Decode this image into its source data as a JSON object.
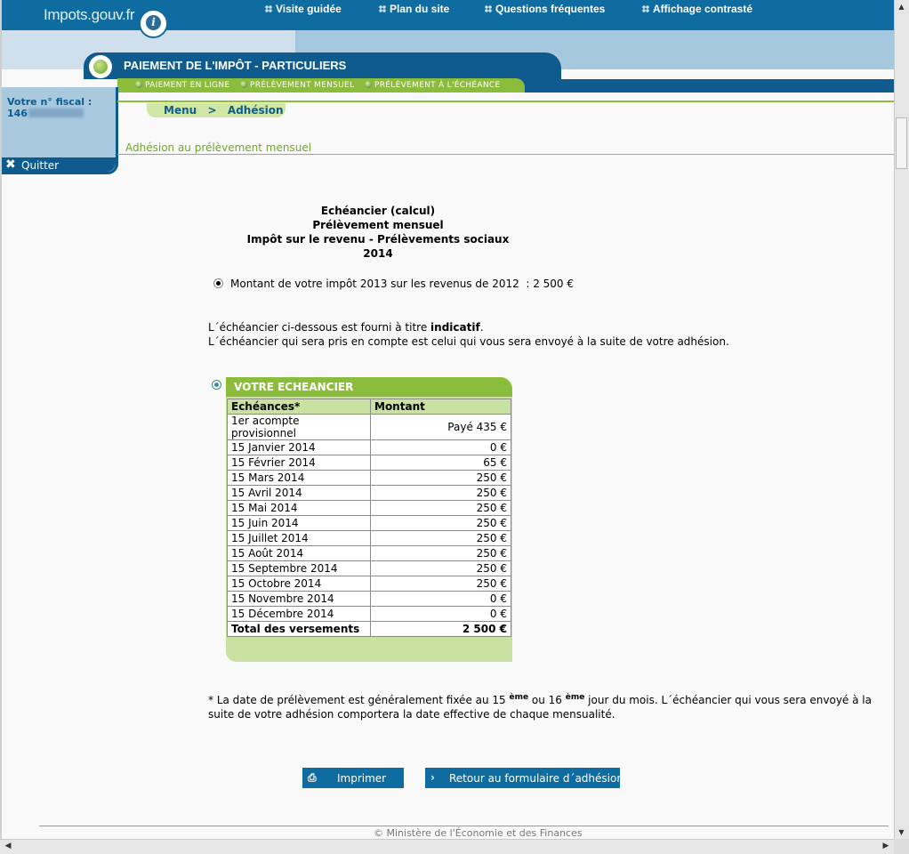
{
  "header": {
    "logo_text": "Impots.gouv.fr",
    "logo_badge": "i",
    "links": [
      "Visite guidée",
      "Plan du site",
      "Questions fréquentes",
      "Affichage contrasté"
    ]
  },
  "section": {
    "title": "PAIEMENT DE L'IMPÔT - PARTICULIERS",
    "subnav": [
      "PAIEMENT EN LIGNE",
      "PRÉLÈVEMENT MENSUEL",
      "PRÉLÈVEMENT À L'ÉCHÉANCE"
    ]
  },
  "sidebar": {
    "fiscal_label": "Votre n° fiscal :",
    "fiscal_prefix": "146",
    "quit_label": "Quitter"
  },
  "breadcrumb": {
    "text": "Menu  >  Adhésion"
  },
  "page_subtitle": "Adhésion au prélèvement mensuel",
  "titles": [
    "Echéancier (calcul)",
    "Prélèvement mensuel",
    "Impôt sur le revenu - Prélèvements sociaux",
    "2014"
  ],
  "amount_line": "Montant de votre impôt 2013 sur les revenus de 2012  : 2 500 €",
  "info": {
    "line1_prefix": "L´échéancier ci-dessous est fourni à titre ",
    "line1_bold": "indicatif",
    "line1_suffix": ".",
    "line2": "L´échéancier qui sera pris en compte est celui qui vous sera envoyé à la suite de votre adhésion."
  },
  "schedule": {
    "title": "VOTRE ECHEANCIER",
    "headers": [
      "Echéances*",
      "Montant"
    ],
    "rows": [
      [
        "1er acompte provisionnel",
        "Payé 435 €"
      ],
      [
        "15 Janvier 2014",
        "0 €"
      ],
      [
        "15 Février 2014",
        "65 €"
      ],
      [
        "15 Mars 2014",
        "250 €"
      ],
      [
        "15 Avril 2014",
        "250 €"
      ],
      [
        "15 Mai 2014",
        "250 €"
      ],
      [
        "15 Juin 2014",
        "250 €"
      ],
      [
        "15 Juillet 2014",
        "250 €"
      ],
      [
        "15 Août 2014",
        "250 €"
      ],
      [
        "15 Septembre 2014",
        "250 €"
      ],
      [
        "15 Octobre 2014",
        "250 €"
      ],
      [
        "15 Novembre 2014",
        "0 €"
      ],
      [
        "15 Décembre 2014",
        "0 €"
      ]
    ],
    "total": [
      "Total des versements",
      "2 500 €"
    ]
  },
  "footnote": {
    "p1": "* La date de prélèvement est généralement fixée au 15 ",
    "sup1": "ème",
    "p2": " ou 16 ",
    "sup2": "ème",
    "p3": " jour du mois. L´échéancier qui vous sera envoyé à la suite de votre adhésion comportera la date effective de chaque mensualité."
  },
  "buttons": {
    "print": "Imprimer",
    "back": "Retour au formulaire d´adhésion"
  },
  "footer": {
    "copyright": "© Ministère de l'Économie et des Finances"
  },
  "colors": {
    "blue_dark": "#0f5b8e",
    "blue": "#0f6ca0",
    "green": "#8cbc3c",
    "green_light": "#c9e2a1"
  }
}
